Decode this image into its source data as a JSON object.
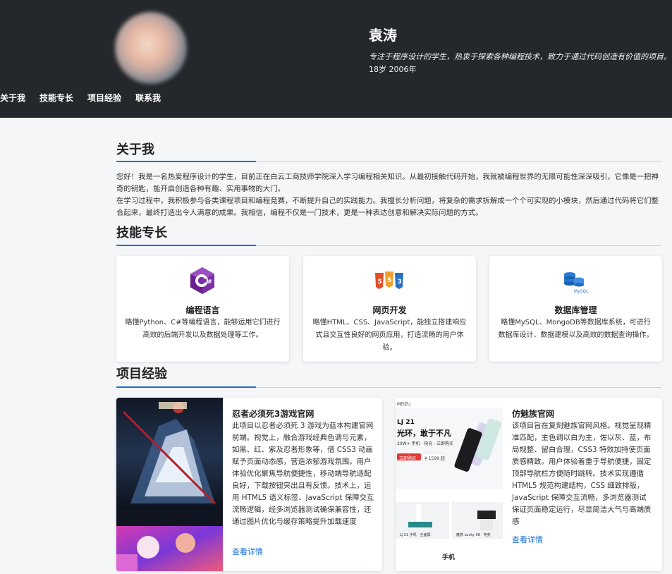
{
  "header": {
    "name": "袁涛",
    "description": "专注于程序设计的学生，热衷于探索各种编程技术，致力于通过代码创造有价值的项目。",
    "age": "18岁 2006年",
    "nav": [
      "关于我",
      "技能专长",
      "项目经验",
      "联系我"
    ]
  },
  "about": {
    "title": "关于我",
    "paragraphs": [
      "您好！我是一名热爱程序设计的学生，目前正在白云工商技师学院深入学习编程相关知识。从最初接触代码开始，我就被编程世界的无限可能性深深吸引，它像是一把神奇的钥匙，能开启创造各种有趣、实用事物的大门。",
      "在学习过程中，我积极参与各类课程项目和编程竞赛，不断提升自己的实践能力。我擅长分析问题，将复杂的需求拆解成一个个可实现的小模块，然后通过代码将它们整合起来，最终打造出令人满意的成果。我相信，编程不仅是一门技术，更是一种表达创意和解决实际问题的方式。"
    ]
  },
  "skills": {
    "title": "技能专长",
    "items": [
      {
        "title": "编程语言",
        "desc": "略懂Python、C#等编程语言，能够运用它们进行高效的后端开发以及数据处理等工作。",
        "icon": "csharp-icon",
        "icon_label": "C#"
      },
      {
        "title": "网页开发",
        "desc": "略懂HTML、CSS、JavaScript，能独立搭建响应式且交互性良好的网页应用，打造流畅的用户体验。",
        "icon": "html-css-js-icon",
        "icon_labels": [
          "5",
          "5",
          "3"
        ]
      },
      {
        "title": "数据库管理",
        "desc": "略懂MySQL、MongoDB等数据库系统，可进行数据库设计、数据建模以及高效的数据查询操作。",
        "icon": "database-icon",
        "icon_label": "MySQL"
      }
    ]
  },
  "projects": {
    "title": "项目经验",
    "items": [
      {
        "title": "忍者必须死3游戏官网",
        "desc": "此项目以忍者必须死 3 游戏为蓝本构建官网前端。视觉上，融合游戏经典色调与元素，如黑、红、紫及忍者形象等，借 CSS3 动画赋予页面动态感，营造浓郁游戏氛围。用户体验优化聚焦导航便捷性，移动端导航适配良好，下载按钮突出且有反馈。技术上，运用 HTML5 语义标签、JavaScript 保障交互流畅逻辑，经多浏览器测试确保兼容性，还通过图片优化与缓存策略提升加载速度",
        "link": "查看详情",
        "image": "ninja-game-screenshot"
      },
      {
        "title": "仿魅族官网",
        "desc": "该项目旨在复刻魅族官网风格。视觉呈现精准匹配，主色调以白为主，佐以灰、蓝，布局规整、留白合理，CSS3 特效加持使页面质感精致。用户体验着重于导航便捷，固定顶部导航栏方便随时跳转。技术实现遵循 HTML5 规范构建结构，CSS 细致排版，JavaScript 保障交互流畅，多浏览器测试保证页面稳定运行，尽显简洁大气与高端质感",
        "link": "查看详情",
        "image": "meizu-site-screenshot"
      }
    ]
  },
  "meizu_image_text": {
    "logo": "MEIZU",
    "model": "LJ 21",
    "slogan": "光环，敢于不凡",
    "sub": "20W+ 手机 · 快充 · 立即购买",
    "btn_buy": "立即购买",
    "price": "¥ 1599 起",
    "caption1": "LJ 21 手机 · 全面屏",
    "caption2": "魅族 Lucky 08 ·  电竞",
    "phone_label": "手机"
  },
  "colors": {
    "header_bg": "#24272b",
    "accent": "#1f6fd6",
    "link": "#1a6fd0",
    "page_bg": "#f4f6f8"
  }
}
